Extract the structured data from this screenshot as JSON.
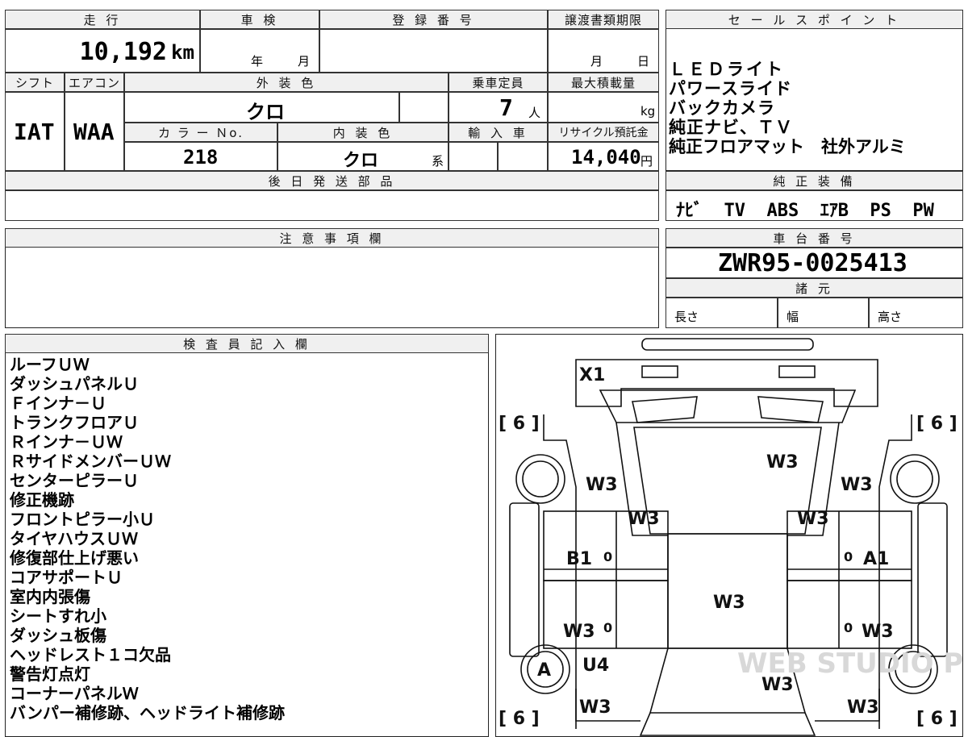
{
  "top_left": {
    "mileage_label": "走 行",
    "inspection_label": "車 検",
    "registration_label": "登 録 番 号",
    "transfer_label": "譲渡書類期限",
    "mileage_value": "10,192",
    "mileage_unit": "km",
    "year_label": "年",
    "month_label": "月",
    "transfer_month": "月",
    "transfer_day": "日",
    "shift_label": "シフト",
    "ac_label": "エアコン",
    "exterior_label": "外 装 色",
    "capacity_label": "乗車定員",
    "max_load_label": "最大積載量",
    "shift_value": "IAT",
    "ac_value": "WAA",
    "exterior_value": "クロ",
    "capacity_value": "7",
    "capacity_unit": "人",
    "max_load_unit": "kg",
    "color_no_label": "カ ラ ー Ｎo.",
    "interior_label": "内 装 色",
    "import_label": "輸 入 車",
    "recycle_label": "リサイクル預託金",
    "color_no_value": "218",
    "interior_value": "クロ",
    "interior_suffix": "系",
    "recycle_value": "14,040",
    "recycle_unit": "円",
    "later_parts_label": "後 日 発 送 部 品"
  },
  "sales_points": {
    "title": "セ ー ル ス ポ イ ン ト",
    "items": [
      "ＬＥＤライト",
      "パワースライド",
      "バックカメラ",
      "純正ナビ、ＴＶ",
      "純正フロアマット　社外アルミ"
    ]
  },
  "genuine_equipment": {
    "title": "純 正 装 備",
    "value": "ﾅﾋﾞ  TV  ABS  ｴｱB  PS  PW"
  },
  "notes": {
    "title": "注 意 事 項 欄"
  },
  "chassis": {
    "title": "車 台 番 号",
    "value": "ZWR95-0025413",
    "specs_label": "諸 元",
    "length_label": "長さ",
    "width_label": "幅",
    "height_label": "高さ"
  },
  "inspector": {
    "title": "検 査 員 記 入 欄",
    "items": [
      "ルーフＵＷ",
      "ダッシュパネルＵ",
      "Ｆインナ－Ｕ",
      "トランクフロアＵ",
      "Ｒインナ－ＵＷ",
      "ＲサイドメンバーＵＷ",
      "センターピラーＵ",
      "修正機跡",
      "フロントピラー小Ｕ",
      "タイヤハウスＵＷ",
      "修復部仕上げ悪い",
      "コアサポートＵ",
      "室内内張傷",
      "シートすれ小",
      "ダッシュ板傷",
      "ヘッドレスト１コ欠品",
      "警告灯点灯",
      "コーナーパネルＷ",
      "バンパー補修跡、ヘッドライト補修跡"
    ]
  },
  "diagram": {
    "marks": [
      "X1",
      "[ 6 ]",
      "[ 6 ]",
      "W3",
      "W3",
      "W3",
      "W3",
      "W3",
      "B1",
      "A1",
      "W3",
      "W3",
      "W3",
      "A",
      "U4",
      "W3",
      "W3",
      "W3",
      "[ 6 ]",
      "[ 6 ]",
      "0",
      "0",
      "0",
      "0"
    ],
    "watermark": "WEB STUDIO PRO"
  }
}
